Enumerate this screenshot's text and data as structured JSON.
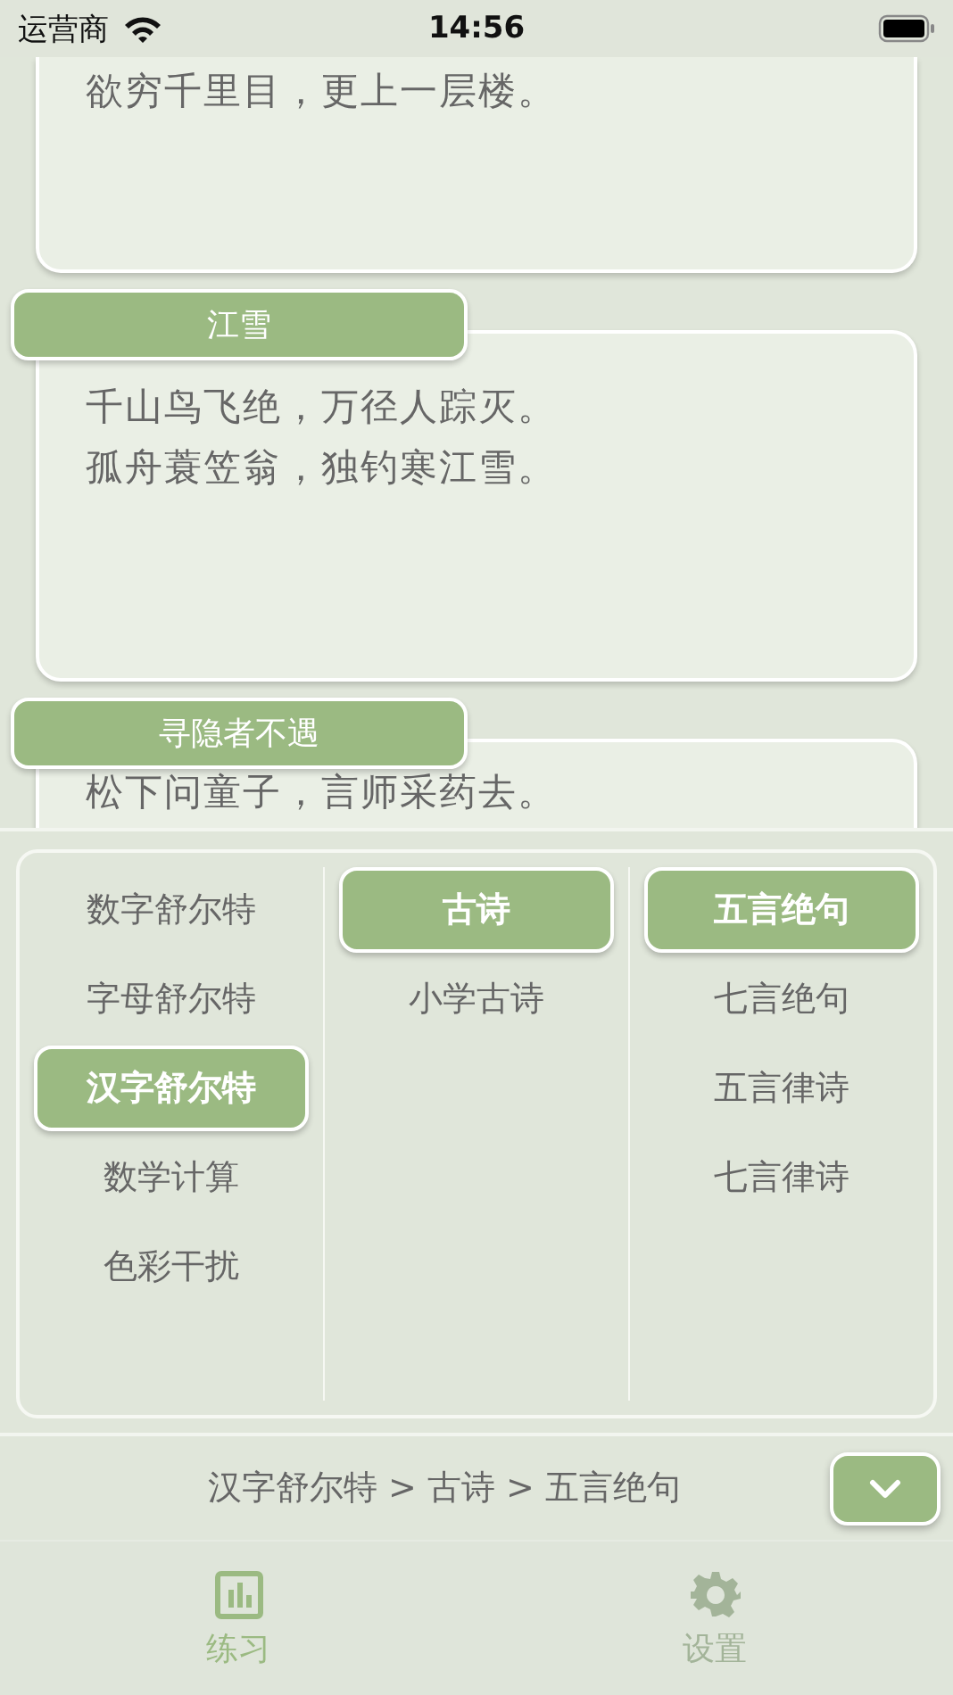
{
  "status_bar": {
    "carrier": "运营商",
    "time": "14:56"
  },
  "top_card": {
    "lines": [
      "欲穷千里目，更上一层楼。"
    ]
  },
  "poems": [
    {
      "title": "江雪",
      "lines": [
        "千山鸟飞绝，万径人踪灭。",
        "孤舟蓑笠翁，独钓寒江雪。"
      ]
    },
    {
      "title": "寻隐者不遇",
      "lines": [
        "松下问童子，言师采药去。"
      ]
    }
  ],
  "picker": [
    {
      "items": [
        {
          "label": "数字舒尔特",
          "selected": false
        },
        {
          "label": "字母舒尔特",
          "selected": false
        },
        {
          "label": "汉字舒尔特",
          "selected": true
        },
        {
          "label": "数学计算",
          "selected": false
        },
        {
          "label": "色彩干扰",
          "selected": false
        }
      ]
    },
    {
      "items": [
        {
          "label": "古诗",
          "selected": true
        },
        {
          "label": "小学古诗",
          "selected": false
        }
      ]
    },
    {
      "items": [
        {
          "label": "五言绝句",
          "selected": true
        },
        {
          "label": "七言绝句",
          "selected": false
        },
        {
          "label": "五言律诗",
          "selected": false
        },
        {
          "label": "七言律诗",
          "selected": false
        }
      ]
    }
  ],
  "breadcrumb": "汉字舒尔特 > 古诗 > 五言绝句",
  "tabs": [
    {
      "label": "练习",
      "kind": "chart",
      "selected": true
    },
    {
      "label": "设置",
      "kind": "gear",
      "selected": false
    }
  ]
}
